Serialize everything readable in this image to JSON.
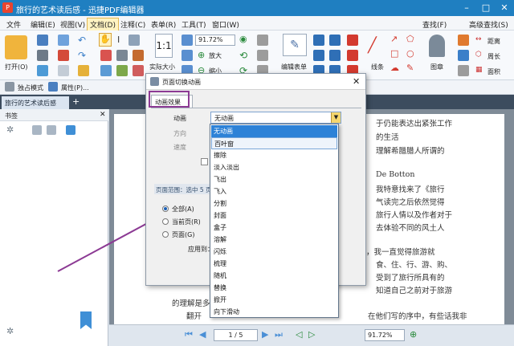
{
  "window": {
    "title": "旅行的艺术读后感 - 迅捷PDF编辑器"
  },
  "menus": [
    "文件",
    "编辑(E)",
    "视图(V)",
    "文档(D)",
    "注释(C)",
    "表单(R)",
    "工具(T)",
    "窗口(W)"
  ],
  "menu_active_index": 3,
  "menu_right": {
    "find": "查找(F)",
    "adv_find": "高级查找(S)"
  },
  "ribbon": {
    "open": "打开(O)",
    "actual_size": "实际大小",
    "zoom_value": "91.72%",
    "zoom_in": "放大",
    "zoom_out": "缩小",
    "edit_form": "编辑表单",
    "line": "线条",
    "stamp": "图章",
    "distance": "距离",
    "perimeter": "周长",
    "area": "面积"
  },
  "toolbar2": {
    "single_mode": "独占模式",
    "properties": "属性(P)..."
  },
  "doc_tab": "旅行的艺术读后感",
  "sidebar": {
    "title": "书签"
  },
  "page_text": [
    "于仍能表达出紧张工作",
    "的生活",
    "理解希腊腊人所谓的",
    "De Botton",
    "我特意找来了《旅行",
    "气读完之后依然觉得",
    "旅行人情以及作者对于",
    "去体验不同的风土人",
    "，我一直觉得旅游就",
    "食、住、行、游、购、",
    "受到了旅行所具有的",
    "知道自己之前对于旅游",
    "的理解是多",
    "翻开",
    "在他们写的序中，有些话我非"
  ],
  "status": {
    "page": "1 / 5",
    "zoom": "91.72%"
  },
  "dialog": {
    "title": "页面切换动画",
    "tab": "动画效果",
    "anim_label": "动画",
    "dir_label": "方向",
    "speed_label": "速度",
    "selected_anim": "无动画",
    "page_range_label": "页面范围：选中 5 页",
    "range_options": [
      "全部(A)",
      "当前页(R)",
      "页面(G)"
    ],
    "apply_to": "应用到：",
    "ok": "确定",
    "cancel": "取消"
  },
  "animations": [
    "无动画",
    "百叶窗",
    "擦除",
    "淡入淡出",
    "飞出",
    "飞入",
    "分割",
    "封面",
    "盒子",
    "溶解",
    "闪烁",
    "梳理",
    "随机",
    "替换",
    "掀开",
    "向下滑动"
  ],
  "selected_index": 0,
  "hover_index": 1,
  "colors": {
    "titlebar": "#1f7fc1",
    "dropdown_selected": "#2d82d7",
    "highlight_box": "#8c3a94",
    "arrow": "#8c3a94"
  }
}
